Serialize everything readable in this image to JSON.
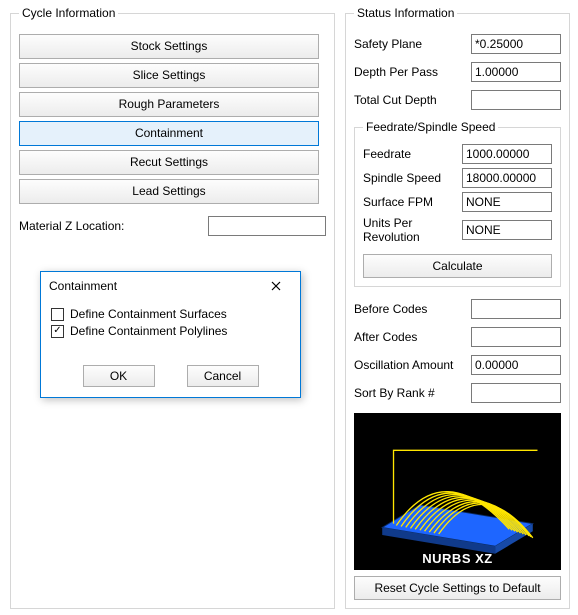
{
  "cycle": {
    "legend": "Cycle Information",
    "buttons": {
      "stock": "Stock Settings",
      "slice": "Slice Settings",
      "rough": "Rough Parameters",
      "containment": "Containment",
      "recut": "Recut Settings",
      "lead": "Lead Settings"
    },
    "material_z_label": "Material Z Location:",
    "material_z_value": ""
  },
  "status": {
    "legend": "Status Information",
    "safety_plane_label": "Safety Plane",
    "safety_plane_value": "*0.25000",
    "depth_per_pass_label": "Depth Per Pass",
    "depth_per_pass_value": "1.00000",
    "total_cut_depth_label": "Total Cut Depth",
    "total_cut_depth_value": "",
    "fs_legend": "Feedrate/Spindle Speed",
    "feedrate_label": "Feedrate",
    "feedrate_value": "1000.00000",
    "spindle_label": "Spindle Speed",
    "spindle_value": "18000.00000",
    "surface_fpm_label": "Surface FPM",
    "surface_fpm_value": "NONE",
    "upr_label": "Units Per Revolution",
    "upr_value": "NONE",
    "calculate": "Calculate",
    "before_codes_label": "Before Codes",
    "before_codes_value": "",
    "after_codes_label": "After Codes",
    "after_codes_value": "",
    "osc_label": "Oscillation Amount",
    "osc_value": "0.00000",
    "sort_label": "Sort By Rank #",
    "sort_value": "",
    "preview_caption": "NURBS XZ",
    "reset": "Reset Cycle Settings to Default"
  },
  "dialog": {
    "title": "Containment",
    "opt_surfaces": "Define Containment Surfaces",
    "opt_surfaces_checked": false,
    "opt_polylines": "Define Containment Polylines",
    "opt_polylines_checked": true,
    "ok": "OK",
    "cancel": "Cancel"
  }
}
